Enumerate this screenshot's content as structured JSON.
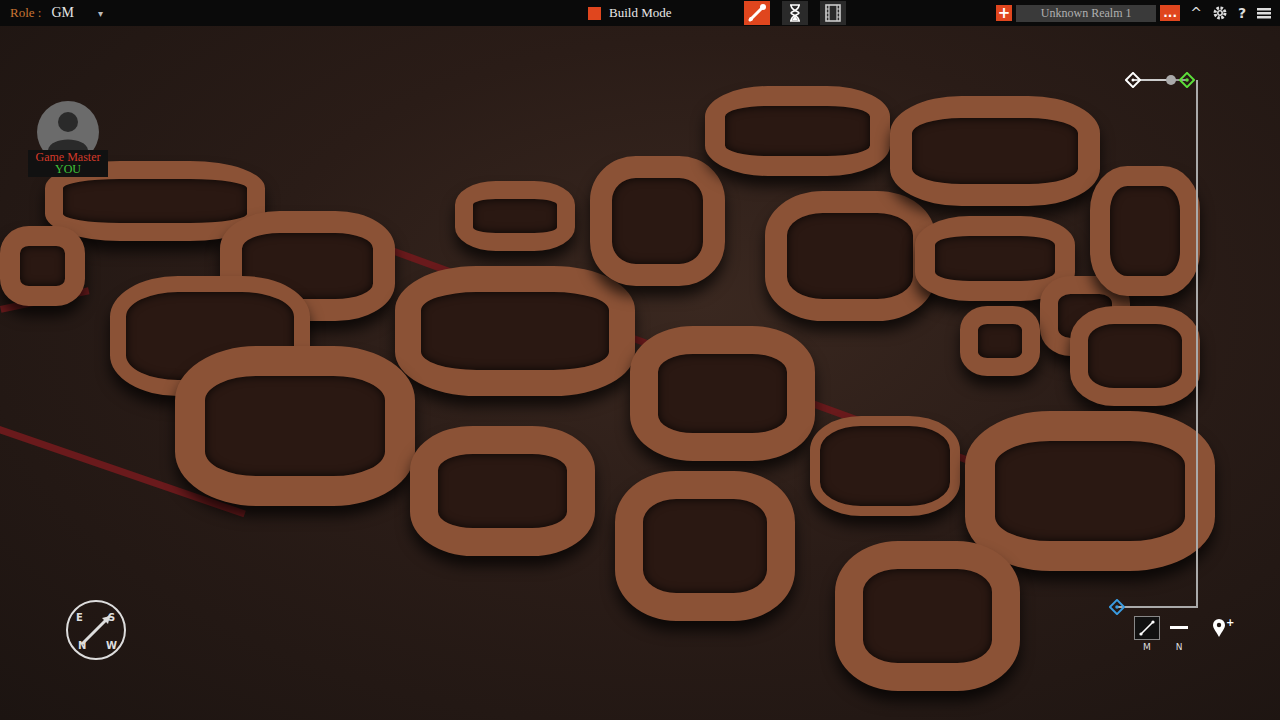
{
  "top_bar": {
    "role_label": "Role :",
    "role_value": "GM",
    "role_caret": "▾",
    "mode_label": "Build Mode",
    "tools": [
      {
        "kind": "build",
        "selected": true
      },
      {
        "kind": "time",
        "selected": false
      },
      {
        "kind": "film",
        "selected": false
      }
    ],
    "realm": {
      "add": "+",
      "name": "Unknown Realm 1",
      "menu": "..."
    },
    "collapse": "^",
    "help": "?"
  },
  "player": {
    "title": "Game Master",
    "name": "YOU"
  },
  "compass": {
    "letters": [
      "E",
      "N",
      "W",
      "S"
    ]
  },
  "height_slider": {
    "level": 0.7
  },
  "bottom_tools": [
    {
      "key": "M",
      "kind": "line",
      "selected": true
    },
    {
      "key": "N",
      "kind": "dash",
      "selected": false
    }
  ],
  "pin": {
    "add": "+"
  }
}
